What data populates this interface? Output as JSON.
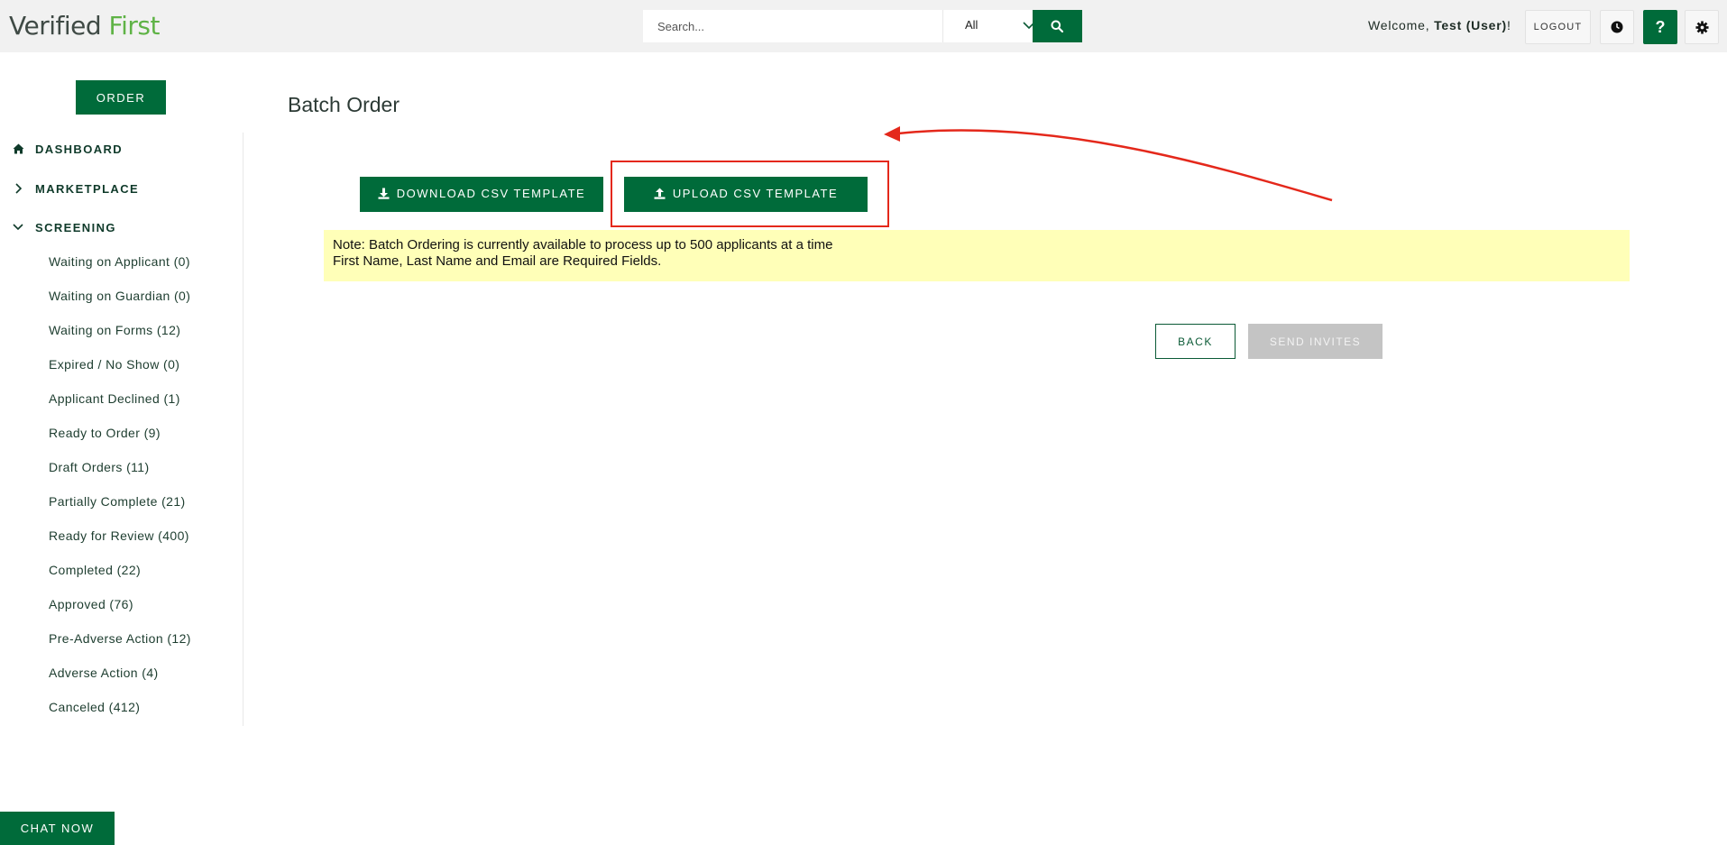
{
  "header": {
    "logo_part1": "Verified",
    "logo_part2": "First",
    "search": {
      "placeholder": "Search...",
      "value": "",
      "filter_selected": "All"
    },
    "welcome_prefix": "Welcome, ",
    "user_name": "Test (User)",
    "welcome_suffix": "!",
    "logout_label": "LOGOUT",
    "help_label": "?"
  },
  "sidebar": {
    "order_label": "ORDER",
    "nav": [
      {
        "label": "DASHBOARD",
        "icon": "home-icon"
      },
      {
        "label": "MARKETPLACE",
        "icon": "chevron-right-icon"
      },
      {
        "label": "SCREENING",
        "icon": "chevron-down-icon"
      }
    ],
    "screening_items": [
      "Waiting on Applicant (0)",
      "Waiting on Guardian (0)",
      "Waiting on Forms (12)",
      "Expired / No Show (0)",
      "Applicant Declined (1)",
      "Ready to Order (9)",
      "Draft Orders (11)",
      "Partially Complete (21)",
      "Ready for Review (400)",
      "Completed (22)",
      "Approved (76)",
      "Pre-Adverse Action (12)",
      "Adverse Action (4)",
      "Canceled (412)"
    ]
  },
  "main": {
    "title": "Batch Order",
    "download_label": "DOWNLOAD CSV TEMPLATE",
    "upload_label": "UPLOAD CSV TEMPLATE",
    "note_line1": "Note: Batch Ordering is currently available to process up to 500 applicants at a time",
    "note_line2": "First Name, Last Name and Email are Required Fields.",
    "back_label": "BACK",
    "send_label": "SEND INVITES"
  },
  "chat_label": "CHAT NOW",
  "colors": {
    "brand_green": "#006b3a",
    "logo_green": "#5fb346",
    "note_bg": "#ffffb8",
    "annotation_red": "#e4281b",
    "disabled_gray": "#c4c4c4"
  }
}
